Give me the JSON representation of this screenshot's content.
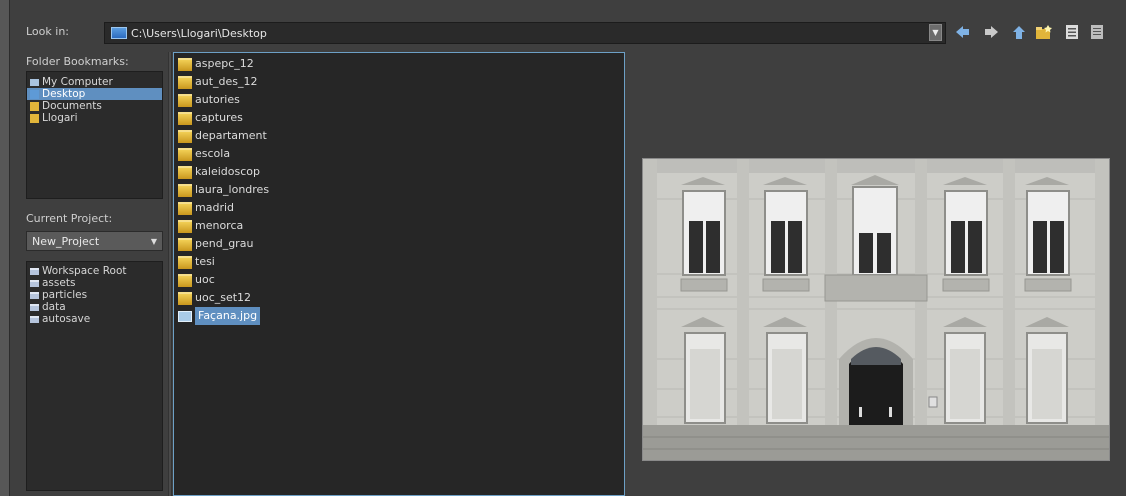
{
  "look_in": {
    "label": "Look in:",
    "path": "C:\\Users\\Llogari\\Desktop"
  },
  "toolbar": {
    "icons": [
      "back-arrow-icon",
      "forward-arrow-icon",
      "home-icon",
      "new-folder-icon",
      "list-view-icon",
      "details-view-icon"
    ]
  },
  "bookmarks": {
    "label": "Folder Bookmarks:",
    "items": [
      "My Computer",
      "Desktop",
      "Documents",
      "Llogari"
    ],
    "selected": "Desktop"
  },
  "project": {
    "label": "Current Project:",
    "value": "New_Project"
  },
  "project_tree": [
    "Workspace Root",
    "assets",
    "particles",
    "data",
    "autosave"
  ],
  "files": {
    "folders": [
      "aspepc_12",
      "aut_des_12",
      "autories",
      "captures",
      "departament",
      "escola",
      "kaleidoscop",
      "laura_londres",
      "madrid",
      "menorca",
      "pend_grau",
      "tesi",
      "uoc",
      "uoc_set12"
    ],
    "images": [
      "Façana.jpg"
    ],
    "selected": "Façana.jpg"
  },
  "colors": {
    "selection": "#5f8fc0",
    "background": "#3f3f3f",
    "panel": "#2b2b2b",
    "folder": "#e1b53a",
    "toolbar_icon": "#7fb2e5"
  }
}
